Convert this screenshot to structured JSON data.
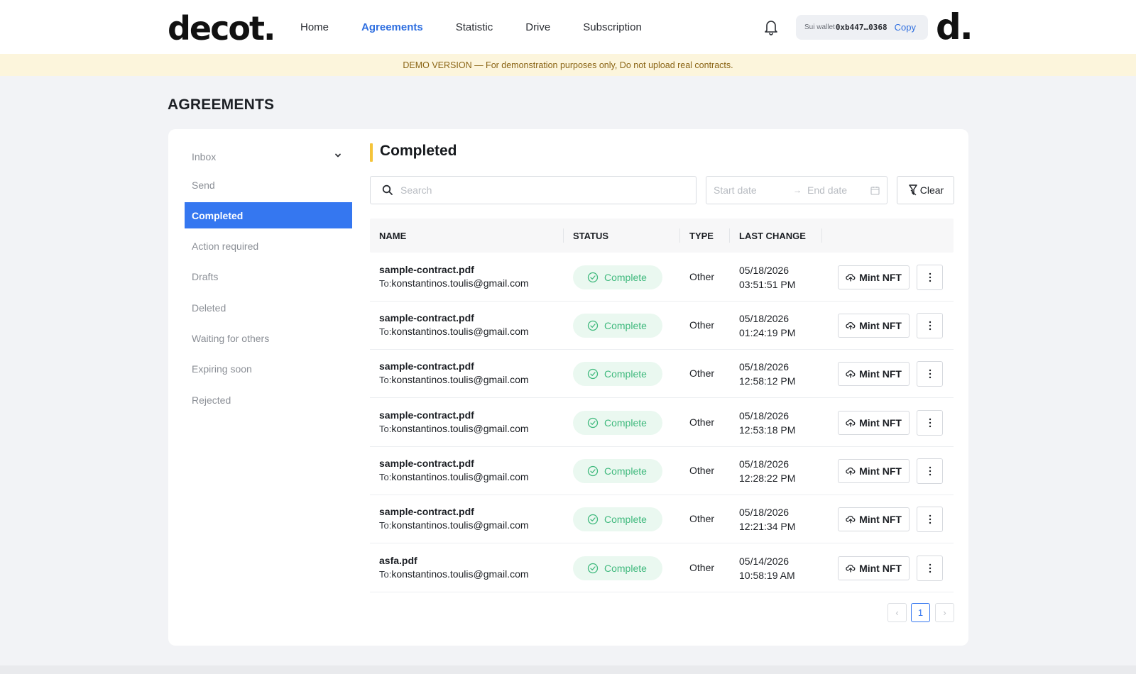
{
  "header": {
    "logo": "decot.",
    "nav": [
      "Home",
      "Agreements",
      "Statistic",
      "Drive",
      "Subscription"
    ],
    "active_nav": "Agreements",
    "wallet_label": "Sui wallet",
    "wallet_address": "0xb447…0368",
    "copy_label": "Copy",
    "user_logo": "d."
  },
  "banner": "DEMO VERSION — For demonstration purposes only, Do not upload real contracts.",
  "page_title": "AGREEMENTS",
  "sidebar": {
    "items": [
      {
        "label": "Inbox"
      },
      {
        "label": "Send"
      },
      {
        "label": "Completed"
      },
      {
        "label": "Action required"
      },
      {
        "label": "Drafts"
      },
      {
        "label": "Deleted"
      },
      {
        "label": "Waiting for others"
      },
      {
        "label": "Expiring soon"
      },
      {
        "label": "Rejected"
      }
    ],
    "active": "Completed"
  },
  "main": {
    "title": "Completed",
    "search_placeholder": "Search",
    "start_placeholder": "Start date",
    "end_placeholder": "End date",
    "clear_label": "Clear",
    "columns": [
      "NAME",
      "STATUS",
      "TYPE",
      "LAST CHANGE"
    ],
    "to_label": "To:",
    "mint_label": "Mint NFT",
    "rows": [
      {
        "name": "sample-contract.pdf",
        "to": "konstantinos.toulis@gmail.com",
        "status": "Complete",
        "type": "Other",
        "date": "05/18/2026",
        "time": "03:51:51 PM"
      },
      {
        "name": "sample-contract.pdf",
        "to": "konstantinos.toulis@gmail.com",
        "status": "Complete",
        "type": "Other",
        "date": "05/18/2026",
        "time": "01:24:19 PM"
      },
      {
        "name": "sample-contract.pdf",
        "to": "konstantinos.toulis@gmail.com",
        "status": "Complete",
        "type": "Other",
        "date": "05/18/2026",
        "time": "12:58:12 PM"
      },
      {
        "name": "sample-contract.pdf",
        "to": "konstantinos.toulis@gmail.com",
        "status": "Complete",
        "type": "Other",
        "date": "05/18/2026",
        "time": "12:53:18 PM"
      },
      {
        "name": "sample-contract.pdf",
        "to": "konstantinos.toulis@gmail.com",
        "status": "Complete",
        "type": "Other",
        "date": "05/18/2026",
        "time": "12:28:22 PM"
      },
      {
        "name": "sample-contract.pdf",
        "to": "konstantinos.toulis@gmail.com",
        "status": "Complete",
        "type": "Other",
        "date": "05/18/2026",
        "time": "12:21:34 PM"
      },
      {
        "name": "asfa.pdf",
        "to": "konstantinos.toulis@gmail.com",
        "status": "Complete",
        "type": "Other",
        "date": "05/14/2026",
        "time": "10:58:19 AM"
      }
    ]
  },
  "pagination": {
    "current": "1"
  },
  "colors": {
    "accent": "#3577f0",
    "success": "#3fb97d",
    "banner_bg": "#fcf5dc",
    "section_marker": "#f5c43a"
  }
}
